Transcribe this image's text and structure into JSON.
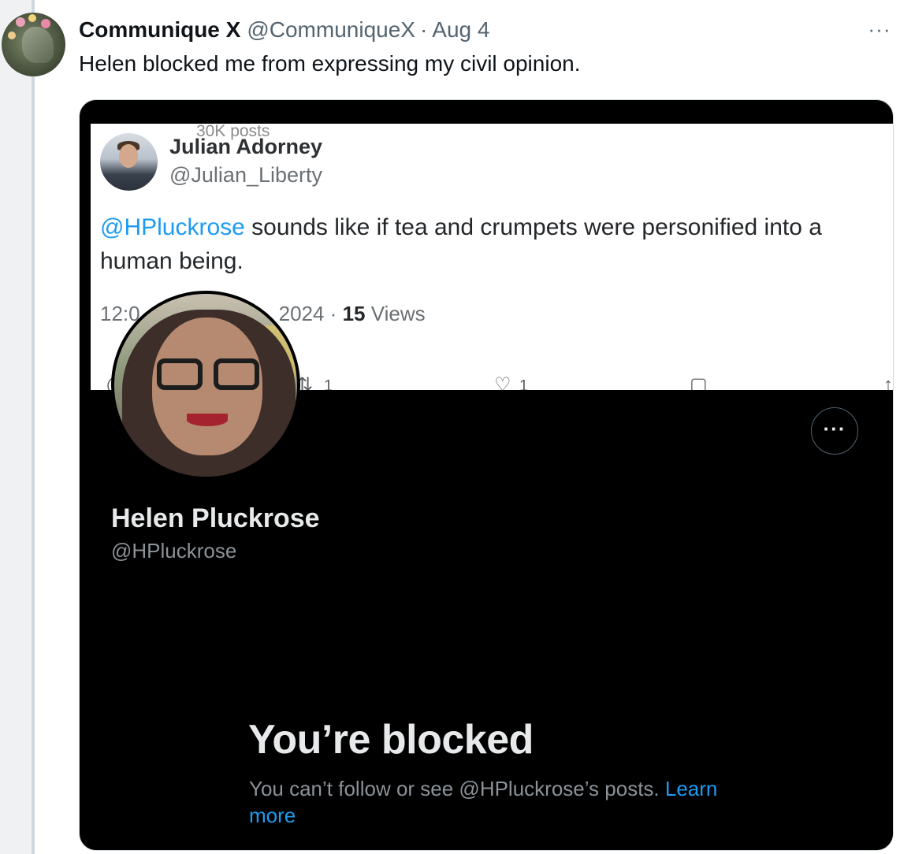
{
  "post": {
    "author_name": "Communique X",
    "author_handle": "@CommuniqueX",
    "separator": "·",
    "date": "Aug 4",
    "more_label": "···",
    "text": "Helen blocked me from expressing my civil opinion."
  },
  "attached_image": {
    "posts_count": "30K posts",
    "quoted_tweet": {
      "author_name": "Julian Adorney",
      "author_handle": "@Julian_Liberty",
      "mention": "@HPluckrose",
      "text_rest": " sounds like if tea and crumpets were personified into a human being.",
      "time_visible_start": "12:0",
      "date_visible_end": "2024 · ",
      "views_count": "15",
      "views_label": " Views",
      "retweet_count": "1",
      "like_count": "1"
    },
    "profile": {
      "name": "Helen Pluckrose",
      "handle": "@HPluckrose",
      "more_label": "···"
    },
    "blocked": {
      "title": "You’re blocked",
      "description": "You can’t follow or see @HPluckrose’s posts. ",
      "learn_more": "Learn more"
    }
  },
  "colors": {
    "accent": "#1d9bf0",
    "text_primary": "#0f1419",
    "text_secondary": "#536471",
    "dark_bg": "#000000"
  }
}
